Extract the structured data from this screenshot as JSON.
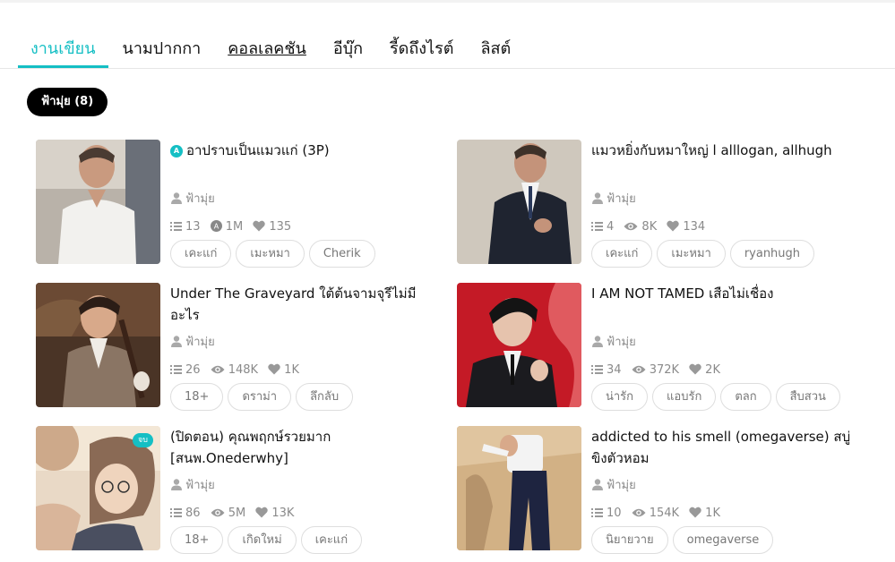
{
  "tabs": [
    {
      "label": "งานเขียน"
    },
    {
      "label": "นามปากกา"
    },
    {
      "label": "คอลเลคชัน"
    },
    {
      "label": "อีบุ๊ก"
    },
    {
      "label": "รี้ดถึงไรต์"
    },
    {
      "label": "ลิสต์"
    }
  ],
  "filter_chip": "ฟ้ามุ่ย (8)",
  "colors": {
    "accent": "#15bfc4",
    "chip_bg": "#000000",
    "muted_text": "#8a8a8a"
  },
  "works": [
    {
      "title": "อาปราบเป็นแมวแก่ (3P)",
      "badge": "A",
      "author": "ฟ้ามุ่ย",
      "chapters": "13",
      "views": "1M",
      "views_icon": "badge-icon",
      "likes": "135",
      "tags": [
        "เคะแก่",
        "เมะหมา",
        "Cherik"
      ]
    },
    {
      "title": "แมวหยิ่งกับหมาใหญ่ l alllogan, allhugh",
      "author": "ฟ้ามุ่ย",
      "chapters": "4",
      "views": "8K",
      "views_icon": "eye-icon",
      "likes": "134",
      "tags": [
        "เคะแก่",
        "เมะหมา",
        "ryanhugh"
      ]
    },
    {
      "title": "Under The Graveyard ใต้ต้นจามจุรีไม่มีอะไร",
      "author": "ฟ้ามุ่ย",
      "chapters": "26",
      "views": "148K",
      "views_icon": "eye-icon",
      "likes": "1K",
      "tags": [
        "18+",
        "ดราม่า",
        "ลึกลับ"
      ]
    },
    {
      "title": "I AM NOT TAMED เสือไม่เชื่อง",
      "author": "ฟ้ามุ่ย",
      "chapters": "34",
      "views": "372K",
      "views_icon": "eye-icon",
      "likes": "2K",
      "tags": [
        "น่ารัก",
        "แอบรัก",
        "ตลก",
        "สืบสวน"
      ]
    },
    {
      "title": "(ปิดตอน) คุณพฤกษ์รวยมาก [สนพ.Onederwhy]",
      "end_label": "จบ",
      "author": "ฟ้ามุ่ย",
      "chapters": "86",
      "views": "5M",
      "views_icon": "eye-icon",
      "likes": "13K",
      "tags": [
        "18+",
        "เกิดใหม่",
        "เคะแก่"
      ]
    },
    {
      "title": "addicted to his smell (omegaverse) สบู่ขิงตัวหอม",
      "author": "ฟ้ามุ่ย",
      "chapters": "10",
      "views": "154K",
      "views_icon": "eye-icon",
      "likes": "1K",
      "tags": [
        "นิยายวาย",
        "omegaverse"
      ]
    }
  ]
}
